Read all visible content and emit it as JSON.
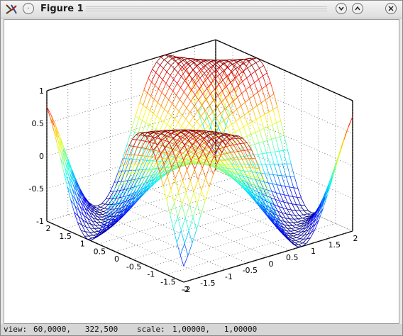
{
  "window": {
    "title": "Figure 1"
  },
  "titlebar_buttons": {
    "menu_icon": "circle-dot",
    "minimize_icon": "chevron-down",
    "maximize_icon": "chevron-up",
    "close_icon": "x"
  },
  "statusbar": {
    "view_label": "view:",
    "view_values": "60,0000,   322,500",
    "scale_label": "scale:",
    "scale_values": "1,00000,   1,00000"
  },
  "chart_data": {
    "type": "surface",
    "mesh": "wireframe",
    "colormap": "jet",
    "x_ticks": [
      "-2",
      "-1.5",
      "-1",
      "-0.5",
      "0",
      "0.5",
      "1",
      "1.5",
      "2"
    ],
    "y_ticks": [
      "-2",
      "-1.5",
      "-1",
      "-0.5",
      "0",
      "0.5",
      "1",
      "1.5",
      "2"
    ],
    "z_ticks": [
      "-1",
      "-0.5",
      "0",
      "0.5",
      "1"
    ],
    "xlim": [
      -2,
      2
    ],
    "ylim": [
      -2,
      2
    ],
    "zlim": [
      -1,
      1
    ],
    "view_azimuth": 60,
    "view_elevation": 322.5,
    "grid": "dotted back planes"
  }
}
